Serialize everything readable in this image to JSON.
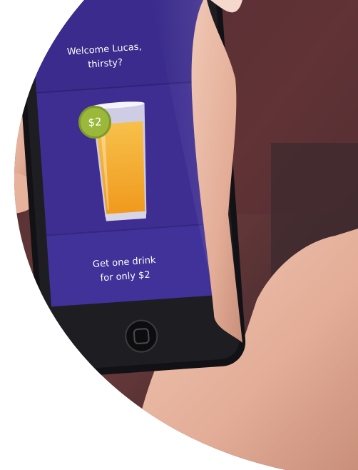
{
  "screen": {
    "welcome_line1": "Welcome Lucas,",
    "welcome_line2": "thirsty?",
    "price": "$2",
    "offer_line1": "Get one drink",
    "offer_line2": "for only $2"
  },
  "colors": {
    "screen_purple": "#3e2e92",
    "badge_green": "#9cb83a",
    "juice_orange": "#f4a629",
    "phone_black": "#121216",
    "skin": "#e6b7a2"
  },
  "icons": {
    "home_button": "home-button-icon",
    "juice_glass": "juice-glass-icon"
  }
}
